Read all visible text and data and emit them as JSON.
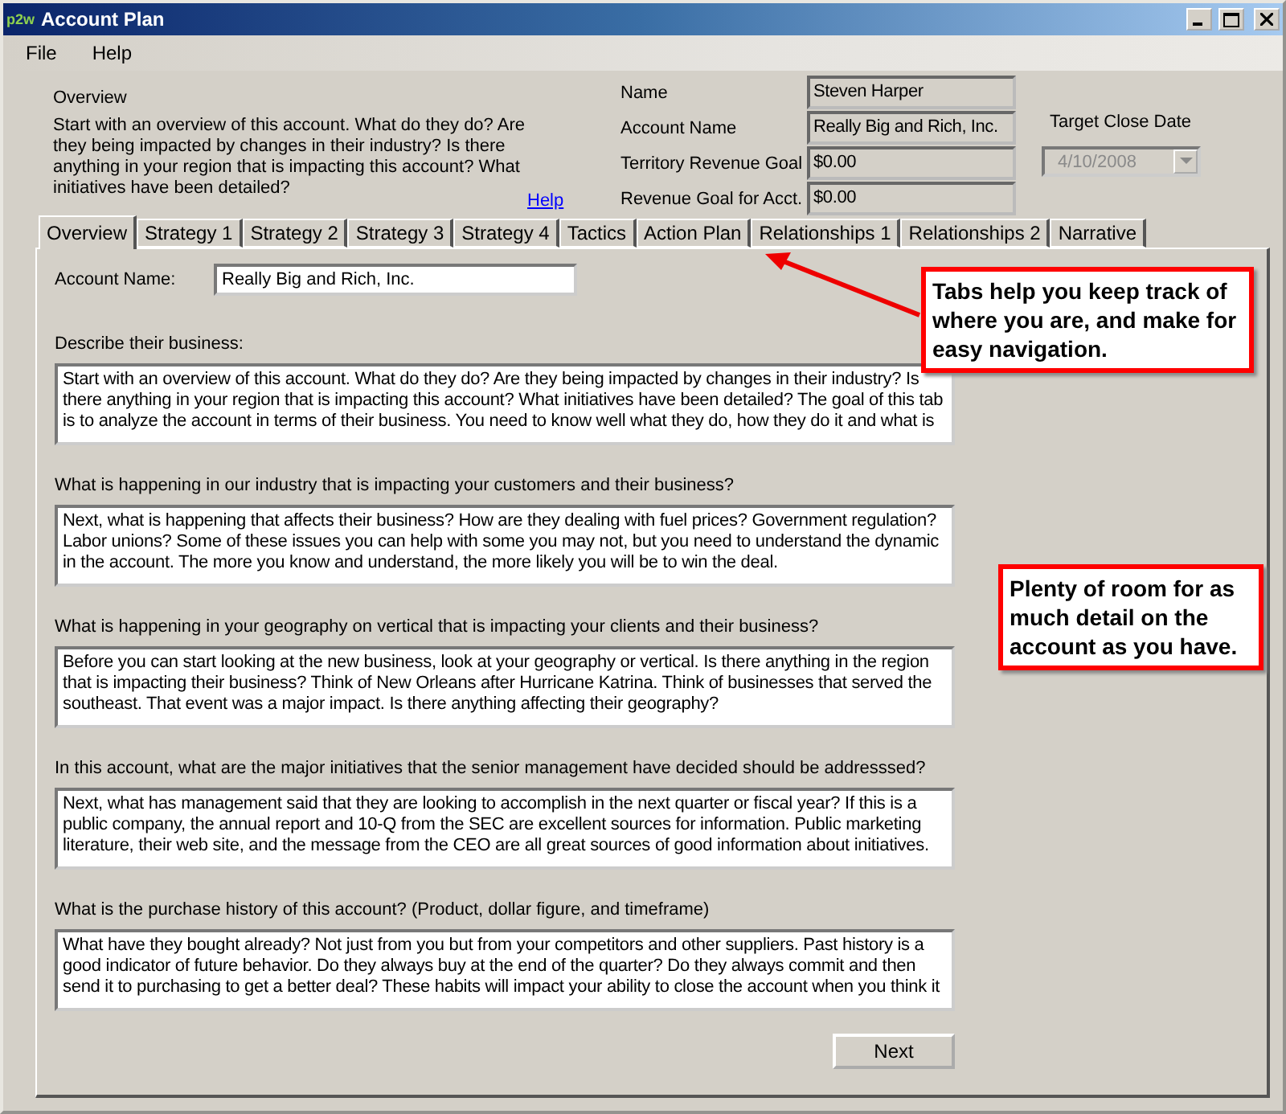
{
  "window": {
    "logo": "p2w",
    "title": "Account Plan"
  },
  "menu": [
    "File",
    "Help"
  ],
  "overview": {
    "title": "Overview",
    "text": "Start with an overview of this account.  What do they do? Are they being impacted by changes in their industry? Is there anything in your region that is impacting this account? What initiatives have been detailed?",
    "help_link": "Help"
  },
  "fields": [
    {
      "label": "Name",
      "value": "Steven Harper"
    },
    {
      "label": "Account Name",
      "value": "Really Big and Rich, Inc."
    },
    {
      "label": "Territory Revenue Goal",
      "value": "$0.00"
    },
    {
      "label": "Revenue Goal for Acct.",
      "value": "$0.00"
    }
  ],
  "target_close_date": {
    "label": "Target Close Date",
    "value": "4/10/2008",
    "disabled": true
  },
  "tabs": [
    {
      "label": "Overview",
      "selected": true
    },
    {
      "label": "Strategy 1",
      "selected": false
    },
    {
      "label": "Strategy 2",
      "selected": false
    },
    {
      "label": "Strategy 3",
      "selected": false
    },
    {
      "label": "Strategy 4",
      "selected": false
    },
    {
      "label": "Tactics",
      "selected": false
    },
    {
      "label": "Action Plan",
      "selected": false
    },
    {
      "label": "Relationships 1",
      "selected": false
    },
    {
      "label": "Relationships 2",
      "selected": false
    },
    {
      "label": "Narrative",
      "selected": false
    }
  ],
  "account_name": {
    "label": "Account Name:",
    "value": "Really Big and Rich, Inc."
  },
  "sections": [
    {
      "question": "Describe their business:",
      "answer": "Start with an overview of this account. What do they do? Are they being impacted by changes in their industry? Is there anything in your region that is impacting this account? What initiatives have been detailed?  The goal of this tab is to analyze the account in terms of their business. You need to know well what they do, how they do it and what is"
    },
    {
      "question": "What is happening in our industry that is impacting your customers and their business?",
      "answer": "Next, what is happening that affects their business? How are they dealing with fuel prices? Government regulation? Labor unions? Some of these issues you can help with some you may not, but you need to understand the dynamic in the account. The more you know and understand, the more likely you will be to win the deal."
    },
    {
      "question": "What is happening in your geography on vertical that is impacting your clients and their business?",
      "answer": "Before you can start looking at the new business, look at your geography or vertical. Is there anything in the region that is impacting their business? Think of New Orleans after Hurricane Katrina. Think of businesses that served the southeast. That event was a major impact. Is there anything affecting their geography?"
    },
    {
      "question": "In this account, what are the major initiatives that the senior management have decided should be addresssed?",
      "answer": "Next, what has management said that they are looking to accomplish in the next quarter or fiscal year? If this is a public company, the annual report and 10-Q from the SEC are excellent sources for information. Public marketing literature, their web site, and the message from the CEO are all great sources of good information about initiatives."
    },
    {
      "question": "What is the purchase history of this account?  (Product, dollar figure, and timeframe)",
      "answer": "What have they bought already? Not just from you but from your competitors and other suppliers. Past history is a good indicator of future behavior. Do they always buy at the end of the quarter? Do they always commit and then send it to purchasing to get a better deal? These habits will impact your ability to close the account when you think it"
    }
  ],
  "buttons": [
    "Next"
  ],
  "callouts": [
    {
      "text": "Tabs help you keep track of where you are, and make for easy navigation."
    },
    {
      "text": "Plenty of room for as much detail on the account as you have."
    }
  ]
}
